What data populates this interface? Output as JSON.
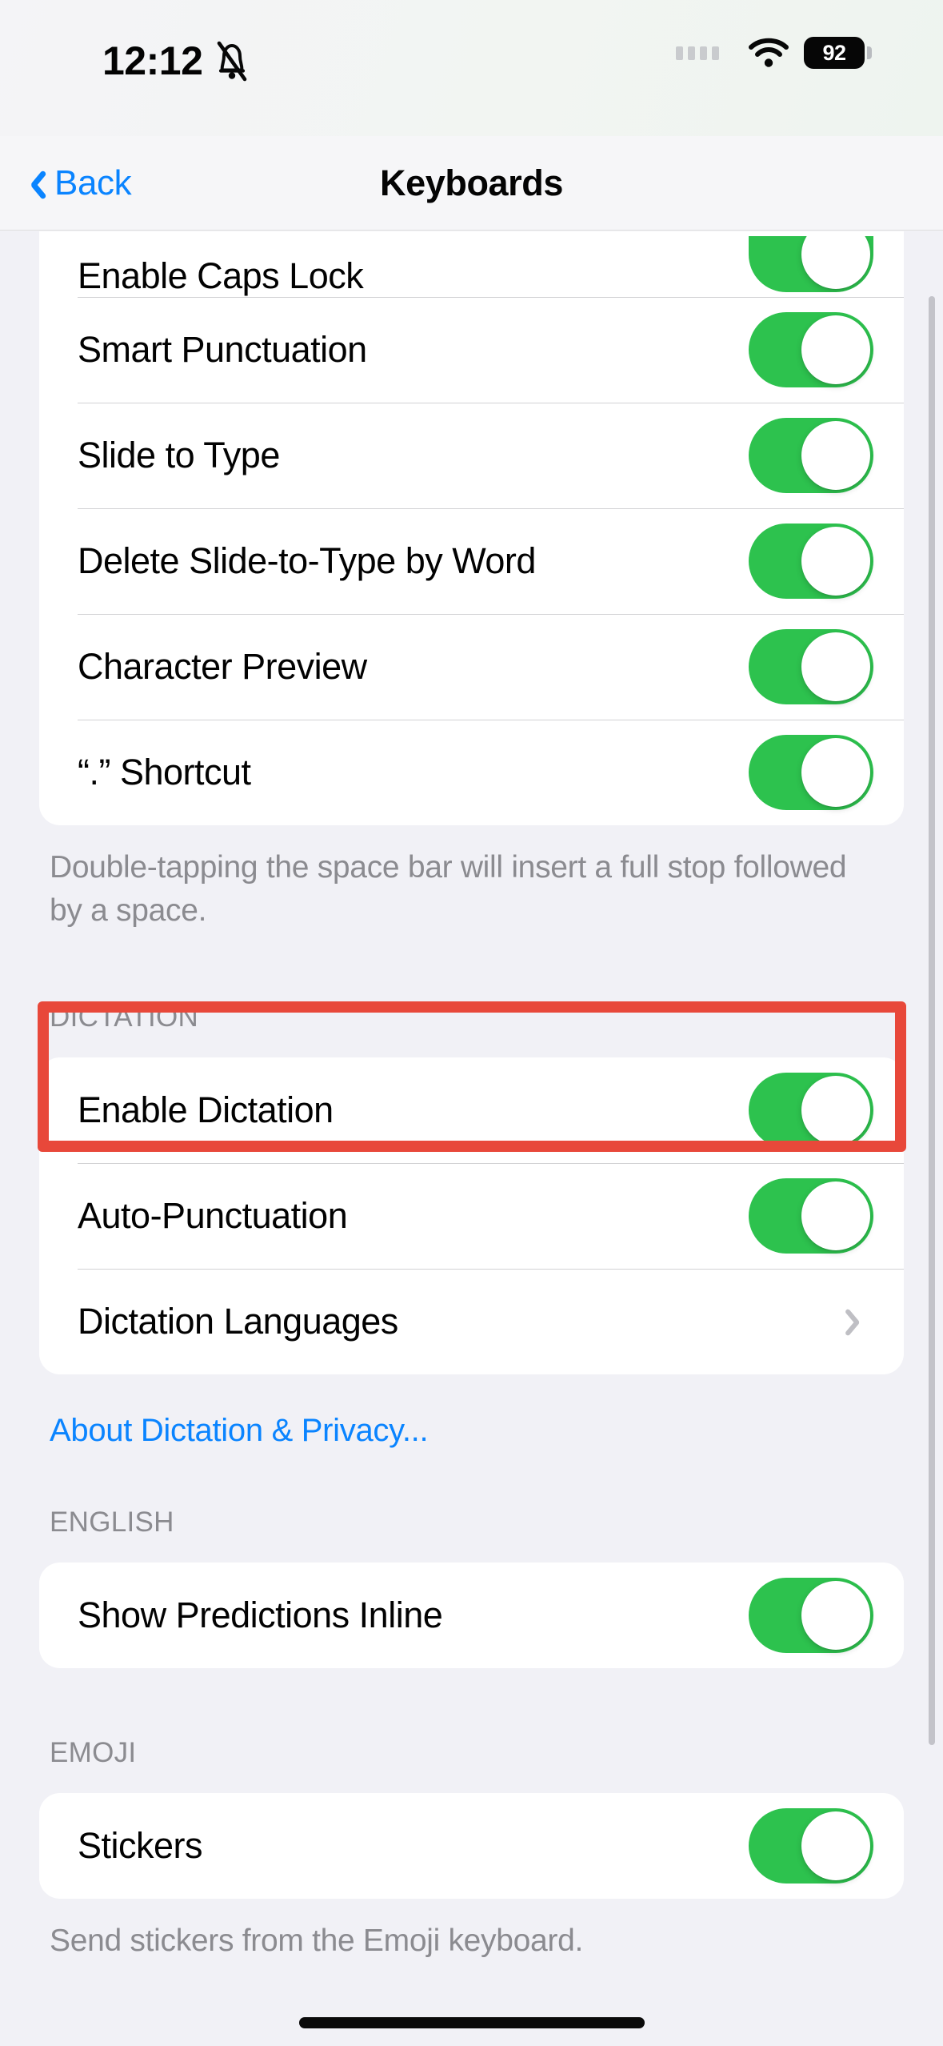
{
  "status_bar": {
    "time": "12:12",
    "silent_icon": "bell-slash-icon",
    "signal_icon": "signal-dots-icon",
    "wifi_icon": "wifi-icon",
    "battery_level": "92"
  },
  "nav": {
    "back_label": "Back",
    "back_icon": "chevron-left-icon",
    "title": "Keyboards"
  },
  "sections": {
    "all_keyboards": {
      "rows": [
        {
          "label": "Enable Caps Lock",
          "control": "toggle",
          "value": "on"
        },
        {
          "label": "Smart Punctuation",
          "control": "toggle",
          "value": "on"
        },
        {
          "label": "Slide to Type",
          "control": "toggle",
          "value": "on"
        },
        {
          "label": "Delete Slide-to-Type by Word",
          "control": "toggle",
          "value": "on"
        },
        {
          "label": "Character Preview",
          "control": "toggle",
          "value": "on"
        },
        {
          "label": "“.” Shortcut",
          "control": "toggle",
          "value": "on"
        }
      ],
      "footer": "Double-tapping the space bar will insert a full stop followed by a space."
    },
    "dictation": {
      "header": "DICTATION",
      "rows": [
        {
          "label": "Enable Dictation",
          "control": "toggle",
          "value": "on"
        },
        {
          "label": "Auto-Punctuation",
          "control": "toggle",
          "value": "on"
        },
        {
          "label": "Dictation Languages",
          "control": "chevron",
          "value": ""
        }
      ],
      "link": "About Dictation & Privacy..."
    },
    "english": {
      "header": "ENGLISH",
      "rows": [
        {
          "label": "Show Predictions Inline",
          "control": "toggle",
          "value": "on"
        }
      ]
    },
    "emoji": {
      "header": "EMOJI",
      "rows": [
        {
          "label": "Stickers",
          "control": "toggle",
          "value": "on"
        }
      ],
      "footer": "Send stickers from the Emoji keyboard."
    }
  },
  "annotation": {
    "highlight_color": "#e8483a",
    "highlight_target": "Enable Dictation"
  },
  "theme": {
    "accent_blue": "#0a84ff",
    "toggle_on_green": "#2dc24e",
    "page_background": "#f1f1f6",
    "card_background": "#ffffff",
    "secondary_text": "#8b8b90"
  }
}
